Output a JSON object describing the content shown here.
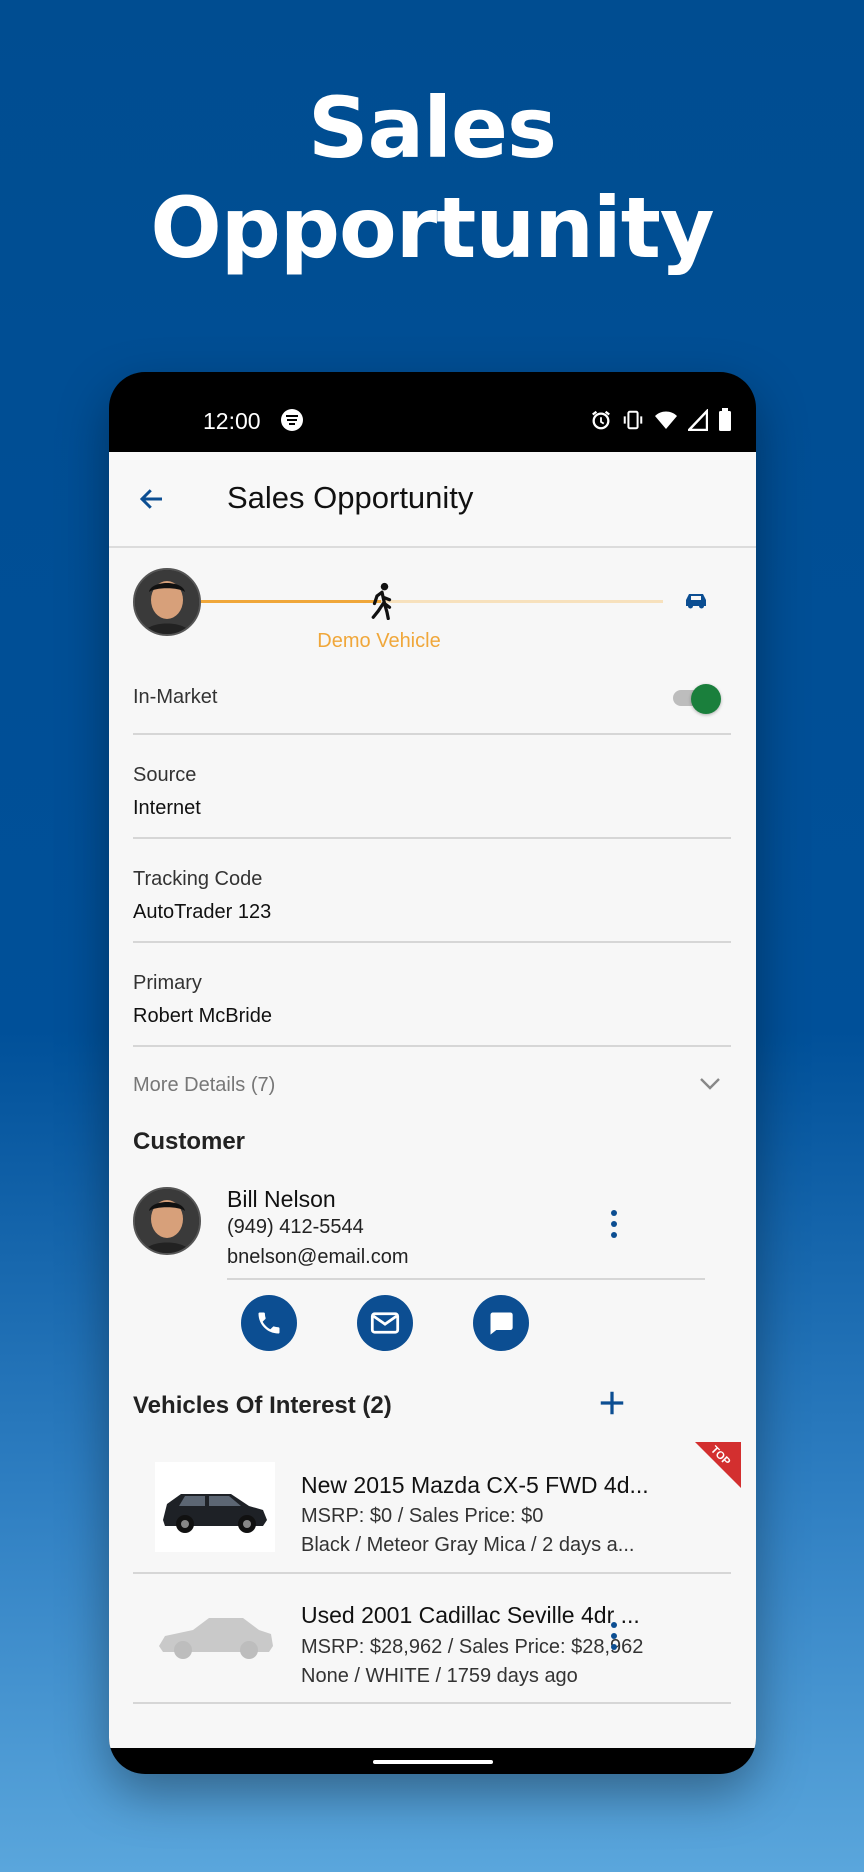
{
  "hero": {
    "line1": "Sales",
    "line2": "Opportunity"
  },
  "status_bar": {
    "time": "12:00"
  },
  "app_bar": {
    "title": "Sales Opportunity"
  },
  "progress": {
    "stage_label": "Demo Vehicle",
    "fraction": 0.5,
    "accent_color": "#f0a73a"
  },
  "in_market": {
    "label": "In-Market",
    "on": true,
    "toggle_color": "#1a7f3c"
  },
  "fields": [
    {
      "label": "Source",
      "value": "Internet"
    },
    {
      "label": "Tracking Code",
      "value": "AutoTrader 123"
    },
    {
      "label": "Primary",
      "value": "Robert McBride"
    }
  ],
  "more_details": {
    "label": "More Details (7)"
  },
  "customer": {
    "section_title": "Customer",
    "name": "Bill Nelson",
    "phone": "(949) 412-5544",
    "email": "bnelson@email.com"
  },
  "vehicles": {
    "section_title": "Vehicles Of Interest (2)",
    "items": [
      {
        "title": "New 2015 Mazda CX-5 FWD 4d...",
        "price": "MSRP: $0 / Sales Price: $0",
        "details": "Black / Meteor Gray Mica / 2 days a...",
        "badge": "TOP"
      },
      {
        "title": "Used 2001 Cadillac Seville 4dr ...",
        "price": "MSRP: $28,962 / Sales Price: $28,962",
        "details": "None / WHITE / 1759 days ago"
      }
    ]
  },
  "colors": {
    "brand": "#0c4e92",
    "accent": "#f0a73a",
    "toggle": "#1a7f3c",
    "badge": "#d32f2f"
  }
}
